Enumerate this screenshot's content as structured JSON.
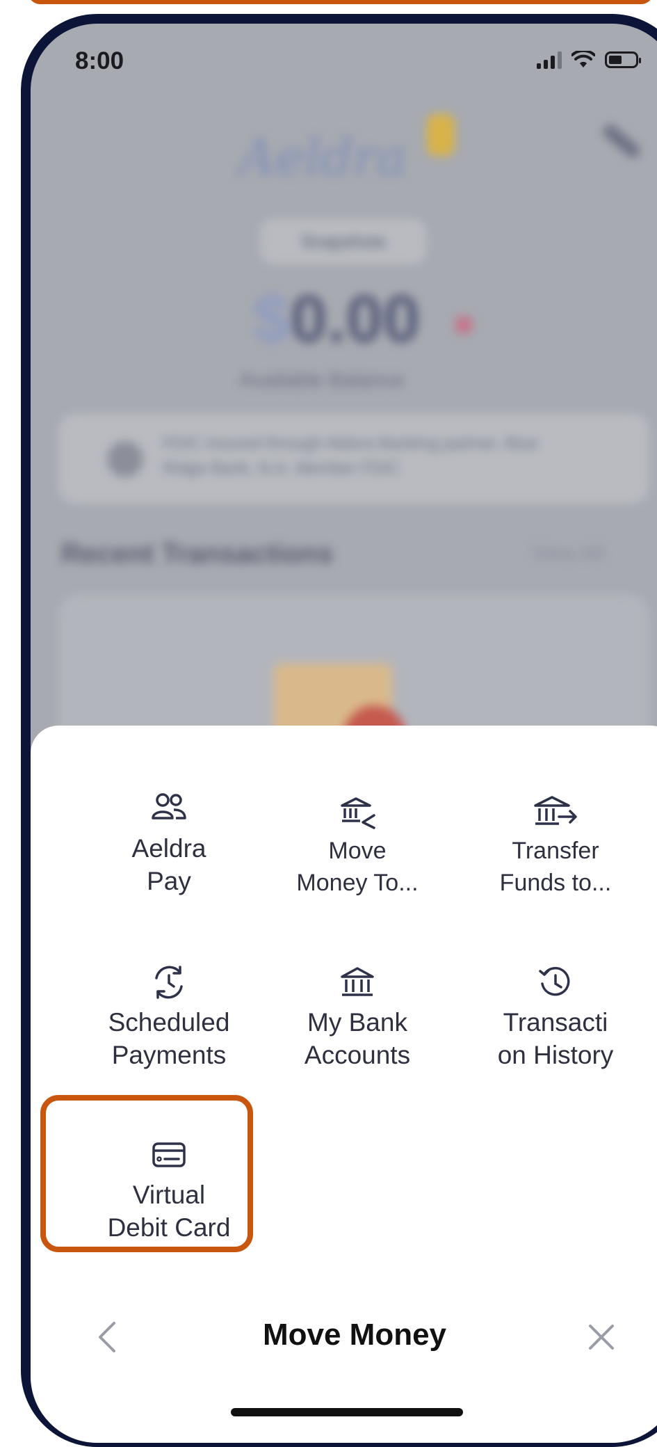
{
  "status_bar": {
    "time": "8:00"
  },
  "background": {
    "account_pill": "Snapshots",
    "balance": "0.00",
    "balance_currency": "$",
    "available_label": "Available Balance",
    "notice_text": "FDIC insured through Aldora Banking partner, Blue Ridge Bank, N.A. Member FDIC",
    "recent_title": "Recent Transactions",
    "view_all": "View All"
  },
  "sheet": {
    "title": "Move Money",
    "items": [
      {
        "label_line1": "Aeldra",
        "label_line2": "Pay",
        "icon": "users-icon"
      },
      {
        "label_line1": "Move",
        "label_line2": "Money To...",
        "icon": "bank-receive-icon"
      },
      {
        "label_line1": "Transfer",
        "label_line2": "Funds to...",
        "icon": "bank-send-icon"
      },
      {
        "label_line1": "Scheduled",
        "label_line2": "Payments",
        "icon": "schedule-refresh-icon"
      },
      {
        "label_line1": "My Bank",
        "label_line2": "Accounts",
        "icon": "bank-icon"
      },
      {
        "label_line1": "Transacti",
        "label_line2": "on History",
        "icon": "history-icon"
      },
      {
        "label_line1": "Virtual",
        "label_line2": "Debit Card",
        "icon": "card-icon"
      }
    ]
  },
  "colors": {
    "highlight": "#c9560e",
    "icon": "#2e3248",
    "phone_frame": "#0c1538"
  }
}
